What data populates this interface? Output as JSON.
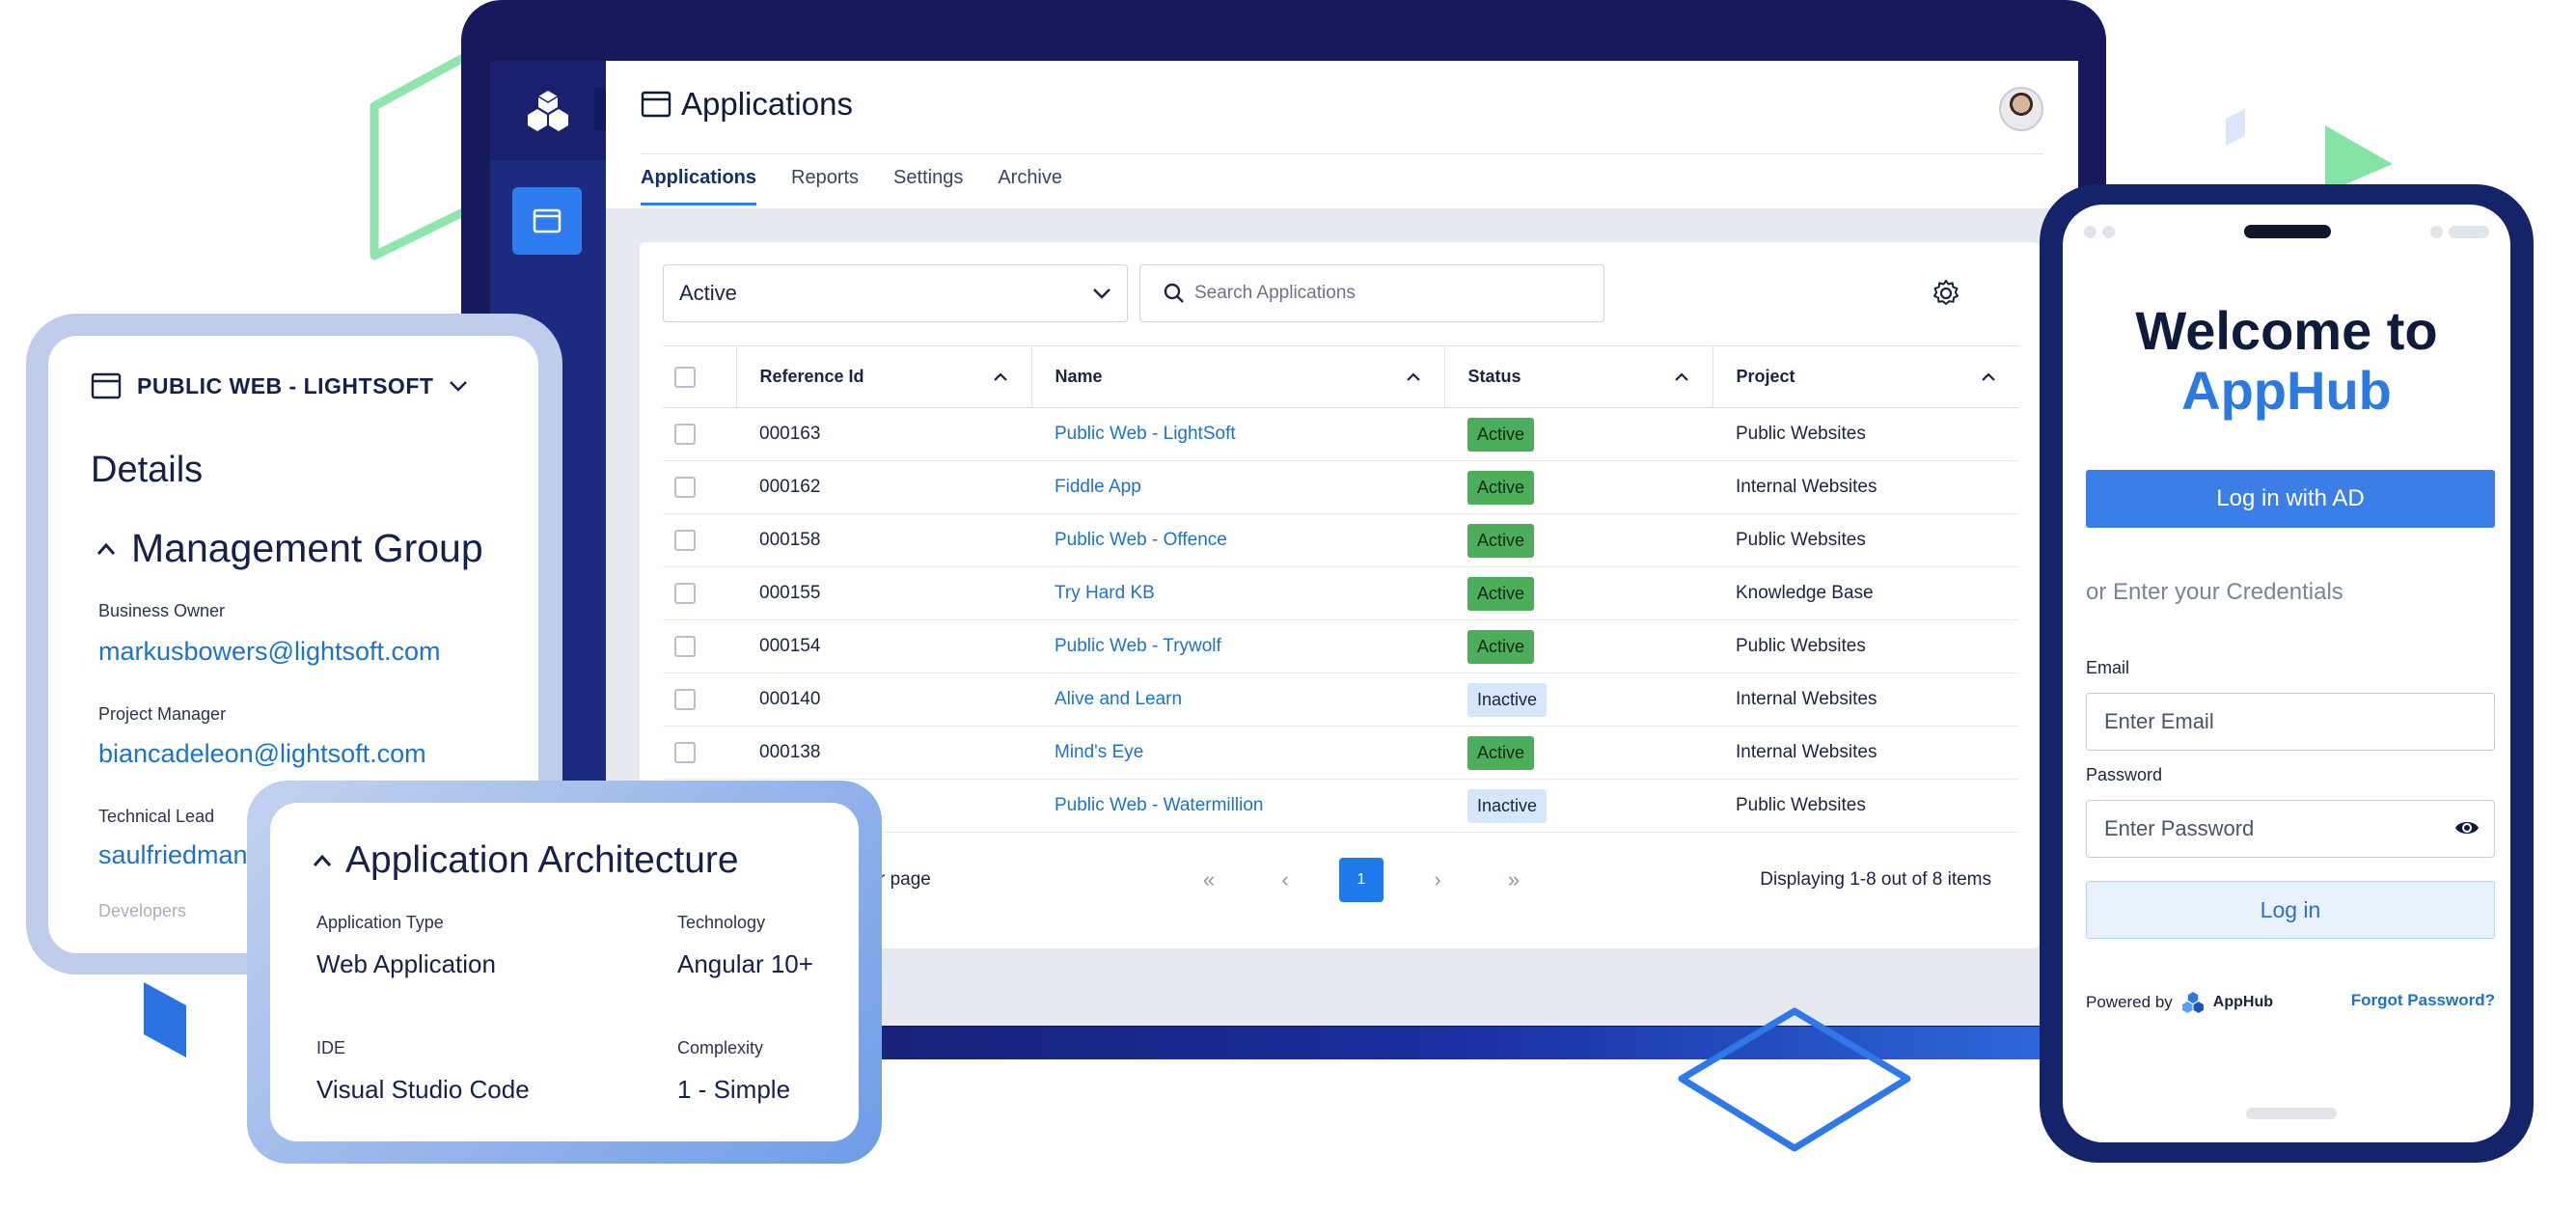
{
  "laptop": {
    "title": "Applications",
    "tabs": [
      {
        "label": "Applications",
        "active": true
      },
      {
        "label": "Reports",
        "active": false
      },
      {
        "label": "Settings",
        "active": false
      },
      {
        "label": "Archive",
        "active": false
      }
    ],
    "filter": {
      "value": "Active"
    },
    "search": {
      "placeholder": "Search Applications"
    },
    "table": {
      "columns": [
        "Reference Id",
        "Name",
        "Status",
        "Project"
      ],
      "rows": [
        {
          "id": "000163",
          "name": "Public Web - LightSoft",
          "status": "Active",
          "project": "Public Websites"
        },
        {
          "id": "000162",
          "name": "Fiddle App",
          "status": "Active",
          "project": "Internal Websites"
        },
        {
          "id": "000158",
          "name": "Public Web - Offence",
          "status": "Active",
          "project": "Public Websites"
        },
        {
          "id": "000155",
          "name": "Try Hard KB",
          "status": "Active",
          "project": "Knowledge Base"
        },
        {
          "id": "000154",
          "name": "Public Web - Trywolf",
          "status": "Active",
          "project": "Public Websites"
        },
        {
          "id": "000140",
          "name": "Alive and Learn",
          "status": "Inactive",
          "project": "Internal Websites"
        },
        {
          "id": "000138",
          "name": "Mind's Eye",
          "status": "Active",
          "project": "Internal Websites"
        },
        {
          "id": "",
          "name": "Public Web - Watermillion",
          "status": "Inactive",
          "project": "Public Websites"
        }
      ]
    },
    "pager": {
      "per_page_label": "r page",
      "first": "«",
      "prev": "‹",
      "current": "1",
      "next": "›",
      "last": "»",
      "info": "Displaying 1-8 out of 8 items"
    }
  },
  "detail_card": {
    "app_name": "PUBLIC WEB - LIGHTSOFT",
    "section_title": "Details",
    "group_title": "Management Group",
    "fields": [
      {
        "label": "Business Owner",
        "value": "markusbowers@lightsoft.com"
      },
      {
        "label": "Project Manager",
        "value": "biancadeleon@lightsoft.com"
      },
      {
        "label": "Technical Lead",
        "value": "saulfriedman"
      },
      {
        "label": "Developers",
        "value": ""
      }
    ]
  },
  "architecture_card": {
    "title": "Application Architecture",
    "fields": [
      {
        "label": "Application Type",
        "value": "Web Application"
      },
      {
        "label": "Technology",
        "value": "Angular 10+"
      },
      {
        "label": "IDE",
        "value": "Visual Studio Code"
      },
      {
        "label": "Complexity",
        "value": "1 - Simple"
      }
    ]
  },
  "phone": {
    "welcome_line1": "Welcome to",
    "welcome_brand": "AppHub",
    "ad_button": "Log in with AD",
    "or_text": "or Enter your Credentials",
    "email_label": "Email",
    "email_placeholder": "Enter Email",
    "password_label": "Password",
    "password_placeholder": "Enter Password",
    "login_button": "Log in",
    "powered_by": "Powered by",
    "powered_brand": "AppHub",
    "forgot": "Forgot Password?"
  },
  "icons": {
    "logo": "cubes-logo-icon",
    "window": "window-icon",
    "chevron": "chevron-down-icon",
    "search": "search-icon",
    "gear": "gear-icon",
    "eye": "eye-icon"
  },
  "colors": {
    "navy": "#16195c",
    "accent_blue": "#2f7bf0",
    "link_blue": "#1c73c9",
    "active_green": "#4cae5a",
    "inactive_blue": "#d6e6fb",
    "deco_green": "#7fe3a0"
  }
}
